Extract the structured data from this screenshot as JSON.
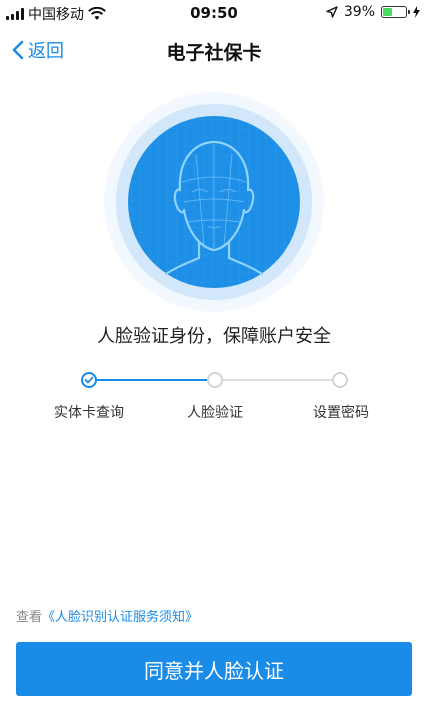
{
  "status_bar": {
    "carrier": "中国移动",
    "time": "09:50",
    "battery_percent": "39%",
    "battery_level": 0.39,
    "icons": [
      "signal-icon",
      "wifi-icon",
      "location-arrow-icon",
      "battery-icon",
      "charging-bolt-icon"
    ]
  },
  "nav": {
    "back_label": "返回",
    "title": "电子社保卡"
  },
  "main": {
    "tagline": "人脸验证身份，保障账户安全",
    "steps": [
      {
        "label": "实体卡查询",
        "state": "done"
      },
      {
        "label": "人脸验证",
        "state": "pending"
      },
      {
        "label": "设置密码",
        "state": "pending"
      }
    ]
  },
  "notice": {
    "prefix": "查看",
    "link": "《人脸识别认证服务须知》"
  },
  "footer": {
    "agree_label": "同意并人脸认证"
  },
  "colors": {
    "accent": "#1a8ce8",
    "circle_inner": "#1d8fe6",
    "circle_halo": "#e8f3fc"
  }
}
